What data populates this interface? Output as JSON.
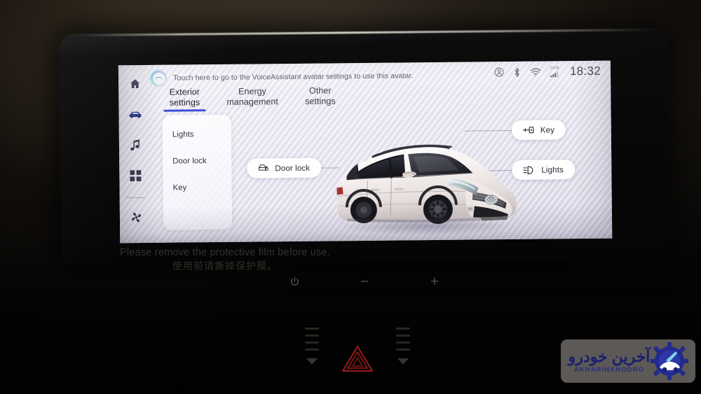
{
  "device": {
    "label": "toyota-rav4-infotainment-head-unit"
  },
  "notification": {
    "text": "Touch here to go to the VoiceAssistant avatar settings to use this avatar.",
    "avatar_icon": "voice-assistant-orb-icon"
  },
  "sidebar": {
    "items": [
      {
        "icon": "home-icon",
        "name": "home",
        "active": false
      },
      {
        "icon": "car-icon",
        "name": "vehicle",
        "active": true
      },
      {
        "icon": "music-icon",
        "name": "media",
        "active": false
      },
      {
        "icon": "apps-grid-icon",
        "name": "apps",
        "active": false
      },
      {
        "icon": "fan-icon",
        "name": "climate",
        "active": false
      }
    ]
  },
  "tabs": [
    {
      "label": "Exterior\nsettings",
      "active": true
    },
    {
      "label": "Energy\nmanagement",
      "active": false
    },
    {
      "label": "Other\nsettings",
      "active": false
    }
  ],
  "status_bar": {
    "icons": [
      {
        "name": "user-account-icon",
        "label": "account"
      },
      {
        "name": "bluetooth-icon",
        "label": "bluetooth"
      },
      {
        "name": "wifi-icon",
        "label": "wifi"
      },
      {
        "name": "dcm-signal-icon",
        "label": "DCM"
      }
    ],
    "dcm_label": "DCM",
    "clock": "18:32"
  },
  "option_card": {
    "items": [
      {
        "label": "Lights"
      },
      {
        "label": "Door lock"
      },
      {
        "label": "Key"
      }
    ]
  },
  "hotspots": [
    {
      "label": "Door lock",
      "icon": "door-lock-icon"
    },
    {
      "label": "Key",
      "icon": "key-icon"
    },
    {
      "label": "Lights",
      "icon": "headlight-icon"
    }
  ],
  "vehicle": {
    "description": "white Toyota RAV4 SUV three-quarter front view",
    "body_color": "#f2eeec"
  },
  "film_warning": {
    "line_en": "Please remove the protective film before use.",
    "line_zh": "使用前请撕掉保护膜。"
  },
  "hard_keys": [
    {
      "name": "power-button",
      "glyph": "power-icon"
    },
    {
      "name": "volume-down-button",
      "glyph": "−"
    },
    {
      "name": "volume-up-button",
      "glyph": "+"
    }
  ],
  "lower_controls": {
    "hazard_label": "hazard-warning-button",
    "vent_left_label": "air-vent-left",
    "vent_right_label": "air-vent-right"
  },
  "watermark": {
    "text_fa": "آخرین خودرو",
    "text_en": "AKHARINKHODRO"
  },
  "colors": {
    "accent": "#3f51d8",
    "screen_bg": "#eceaf3",
    "text_primary": "#2c2a37",
    "hazard_red": "#b32020",
    "wm_blue": "#1a1e6e"
  }
}
